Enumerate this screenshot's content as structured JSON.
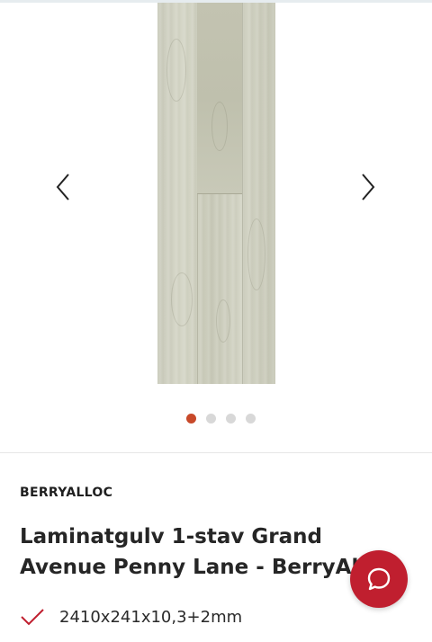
{
  "gallery": {
    "image_alt": "Laminatgulv 1-stav Grand Avenue Penny Lane",
    "prev_icon": "chevron-left-icon",
    "next_icon": "chevron-right-icon",
    "dots_total": 4,
    "active_dot": 0
  },
  "product": {
    "brand": "BERRYALLOC",
    "title": "Laminatgulv 1-stav Grand Avenue Penny Lane - BerryAlloc",
    "spec": "2410x241x10,3+2mm",
    "spec_icon": "checkmark-icon"
  },
  "chat": {
    "icon": "chat-bubble-icon"
  },
  "colors": {
    "accent": "#c01f2f",
    "active_dot": "#c8492a",
    "inactive_dot": "#d8d8d8",
    "check": "#c01f2f"
  }
}
